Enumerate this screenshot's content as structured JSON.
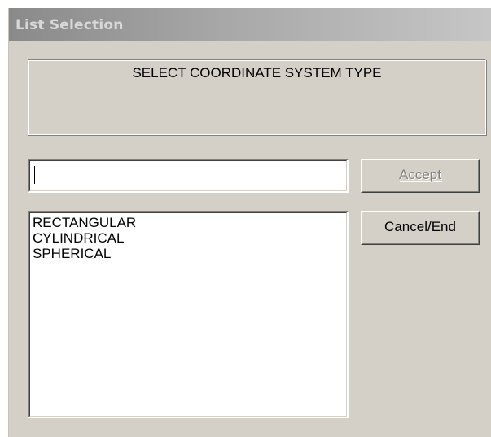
{
  "window": {
    "title": "List Selection"
  },
  "prompt": {
    "text": "SELECT COORDINATE SYSTEM TYPE"
  },
  "input": {
    "value": ""
  },
  "list": {
    "items": [
      {
        "label": "RECTANGULAR"
      },
      {
        "label": "CYLINDRICAL"
      },
      {
        "label": "SPHERICAL"
      }
    ]
  },
  "buttons": {
    "accept_label": "Accept",
    "accept_enabled": false,
    "cancel_label": "Cancel/End"
  },
  "colors": {
    "dialog_face": "#d4d0c8",
    "titlebar_inactive": "#a8a8a8",
    "disabled_text": "#808080"
  }
}
